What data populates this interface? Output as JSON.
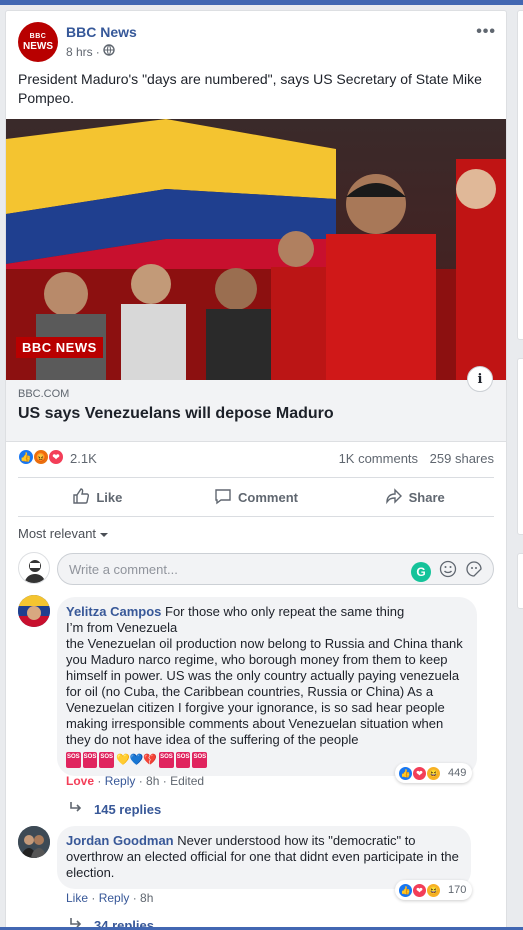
{
  "post": {
    "page_name": "BBC News",
    "avatar_text_top": "BBC",
    "avatar_text_bottom": "NEWS",
    "time": "8 hrs",
    "separator": "·",
    "text": "President Maduro's \"days are numbered\", says US Secretary of State Mike Pompeo.",
    "more_label": "•••",
    "photo_watermark": "BBC NEWS"
  },
  "link": {
    "domain": "BBC.COM",
    "title": "US says Venezuelans will depose Maduro",
    "info_label": "i"
  },
  "reactions": {
    "count": "2.1K",
    "comments": "1K comments",
    "shares": "259 shares"
  },
  "actions": {
    "like": "Like",
    "comment": "Comment",
    "share": "Share"
  },
  "sort": {
    "label": "Most relevant"
  },
  "composer": {
    "placeholder": "Write a comment..."
  },
  "comments": [
    {
      "author": "Yelitza Campos",
      "text_first": "For those who only repeat the same thing",
      "text_rest": "I’m from Venezuela\nthe Venezuelan oil production now belong to Russia and China thank you Maduro narco regime, who borough money from them to keep himself in power. US was the only country actually paying venezuela for oil (no Cuba, the Caribbean countries, Russia or China) As a Venezuelan citizen I forgive your ignorance, is so sad hear people making irresponsible comments about Venezuelan situation when they do not have idea of the suffering of the people",
      "emoji_hearts": "💛💙💔",
      "sos_label": "SOS",
      "reaction_label": "Love",
      "reply_label": "Reply",
      "time": "8h",
      "edited": "Edited",
      "reaction_count": "449",
      "replies": "145 replies"
    },
    {
      "author": "Jordan Goodman",
      "text_first": "Never understood how its \"democratic\" to overthrow an elected official for one that didnt even participate in the election.",
      "like_label": "Like",
      "reply_label": "Reply",
      "time": "8h",
      "reaction_count": "170",
      "replies": "34 replies"
    }
  ],
  "colors": {
    "facebook_blue": "#4267b2",
    "link_blue": "#385898",
    "bbc_red": "#b80000",
    "love_red": "#f33e58"
  }
}
